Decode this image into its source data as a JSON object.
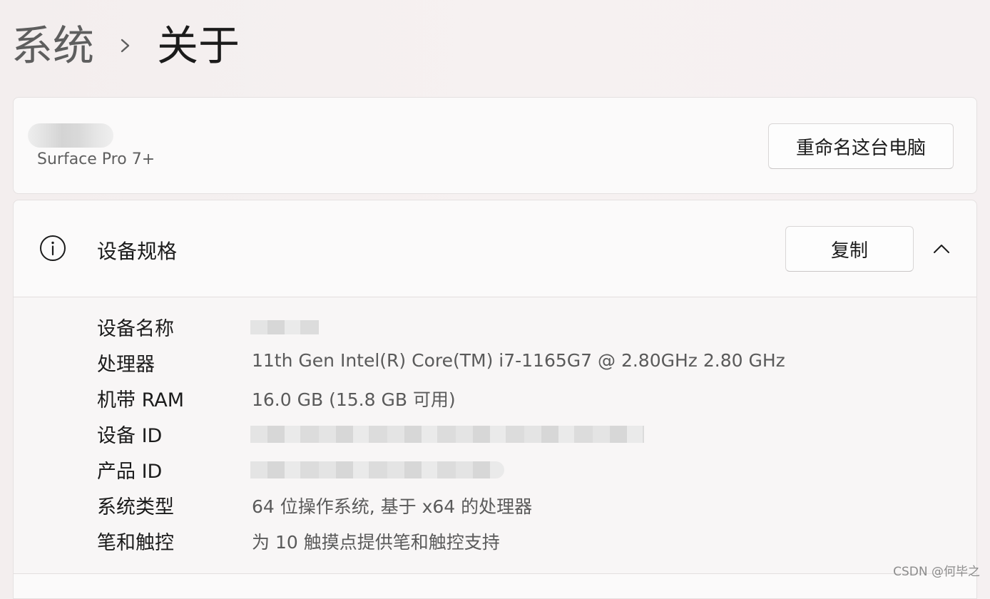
{
  "breadcrumb": {
    "parent": "系统",
    "current": "关于"
  },
  "device": {
    "model": "Surface Pro 7+",
    "rename_label": "重命名这台电脑"
  },
  "specs": {
    "title": "设备规格",
    "copy_label": "复制",
    "rows": [
      {
        "label": "设备名称",
        "value": ""
      },
      {
        "label": "处理器",
        "value": "11th Gen Intel(R) Core(TM) i7-1165G7 @ 2.80GHz   2.80 GHz"
      },
      {
        "label": "机带 RAM",
        "value": "16.0 GB (15.8 GB 可用)"
      },
      {
        "label": "设备 ID",
        "value": ""
      },
      {
        "label": "产品 ID",
        "value": ""
      },
      {
        "label": "系统类型",
        "value": "64 位操作系统, 基于 x64 的处理器"
      },
      {
        "label": "笔和触控",
        "value": "为 10 触摸点提供笔和触控支持"
      }
    ]
  },
  "icons": {
    "breadcrumb_separator": "chevron-right-icon",
    "specs": "info-icon",
    "collapse": "chevron-up-icon"
  },
  "watermark": "CSDN @何毕之"
}
